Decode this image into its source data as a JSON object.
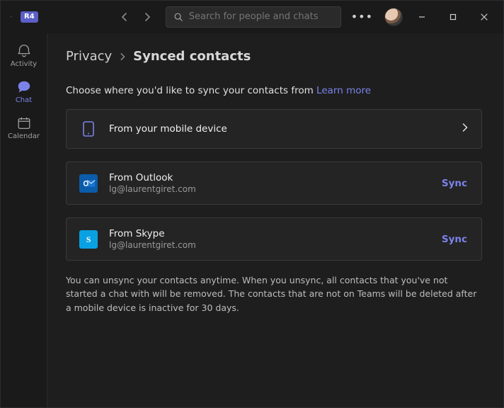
{
  "titlebar": {
    "badge": "R4",
    "search_placeholder": "Search for people and chats"
  },
  "rail": {
    "items": [
      {
        "key": "activity",
        "label": "Activity"
      },
      {
        "key": "chat",
        "label": "Chat",
        "active": true
      },
      {
        "key": "calendar",
        "label": "Calendar"
      }
    ]
  },
  "breadcrumb": {
    "parent": "Privacy",
    "current": "Synced contacts"
  },
  "lead": {
    "text": "Choose where you'd like to sync your contacts from ",
    "link": "Learn more"
  },
  "sources": [
    {
      "key": "mobile",
      "title": "From your mobile device",
      "subtitle": "",
      "action_type": "chevron"
    },
    {
      "key": "outlook",
      "title": "From Outlook",
      "subtitle": "lg@laurentgiret.com",
      "action_type": "sync",
      "action_label": "Sync"
    },
    {
      "key": "skype",
      "title": "From Skype",
      "subtitle": "lg@laurentgiret.com",
      "action_type": "sync",
      "action_label": "Sync"
    }
  ],
  "footnote": "You can unsync your contacts anytime. When you unsync, all contacts that you've not started a chat with will be removed. The contacts that are not on Teams will be deleted after a mobile device is inactive for 30 days.",
  "colors": {
    "accent": "#7b83eb"
  }
}
